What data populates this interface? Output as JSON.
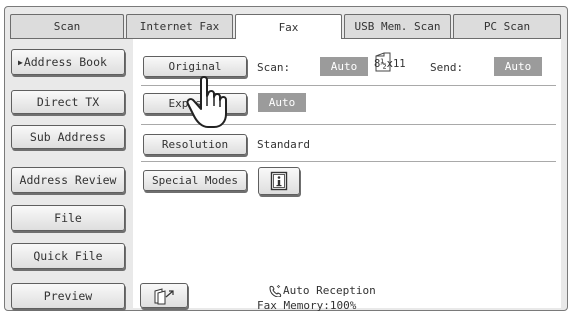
{
  "tabs": [
    {
      "label": "Scan",
      "active": false
    },
    {
      "label": "Internet Fax",
      "active": false
    },
    {
      "label": "Fax",
      "active": true
    },
    {
      "label": "USB Mem. Scan",
      "active": false
    },
    {
      "label": "PC Scan",
      "active": false
    }
  ],
  "sidebar": {
    "items": [
      {
        "label": "Address Book",
        "active": true
      },
      {
        "label": "Direct TX",
        "active": false
      },
      {
        "label": "Sub Address",
        "active": false
      },
      {
        "label": "Address Review",
        "active": false
      },
      {
        "label": "File",
        "active": false
      },
      {
        "label": "Quick File",
        "active": false
      },
      {
        "label": "Preview",
        "active": false
      }
    ]
  },
  "settings": {
    "original": {
      "button_label": "Original",
      "scan_label": "Scan:",
      "scan_value": "Auto",
      "paper_size": "8½x11",
      "send_label": "Send:",
      "send_value": "Auto"
    },
    "exposure": {
      "button_label": "Exposure",
      "value": "Auto"
    },
    "resolution": {
      "button_label": "Resolution",
      "value": "Standard"
    },
    "special_modes": {
      "button_label": "Special Modes"
    }
  },
  "status": {
    "reception": "Auto Reception",
    "memory": "Fax Memory:100%"
  },
  "colors": {
    "badge_gray": "#9b9b9b",
    "panel_gray": "#e9e9e9",
    "border_gray": "#6d6d6d"
  },
  "icons": {
    "pointer": "pointing-hand-icon",
    "info": "info-icon",
    "send_doc": "send-document-icon",
    "phone": "phone-icon",
    "paper": "paper-size-icon"
  }
}
